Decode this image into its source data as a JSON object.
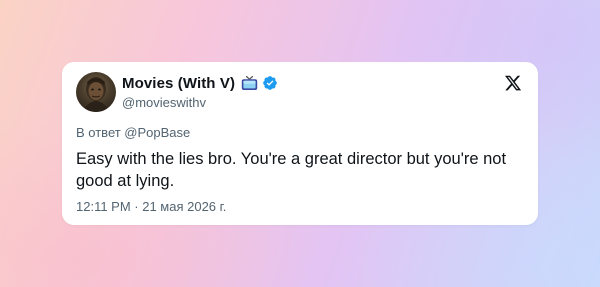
{
  "tweet": {
    "display_name": "Movies (With V)",
    "handle": "@movieswithv",
    "reply_context": "В ответ @PopBase",
    "text": "Easy with the lies bro.  You're a great director but you're not good at lying.",
    "timestamp": "12:11 PM · 21 мая 2026 г."
  },
  "icons": {
    "name_emoji": "tv-icon",
    "verified": "verified-badge-icon",
    "platform": "x-logo-icon"
  },
  "colors": {
    "verified": "#1d9bf0",
    "tv_body": "#2f3d8c",
    "text_primary": "#0f1419",
    "text_secondary": "#536471"
  }
}
